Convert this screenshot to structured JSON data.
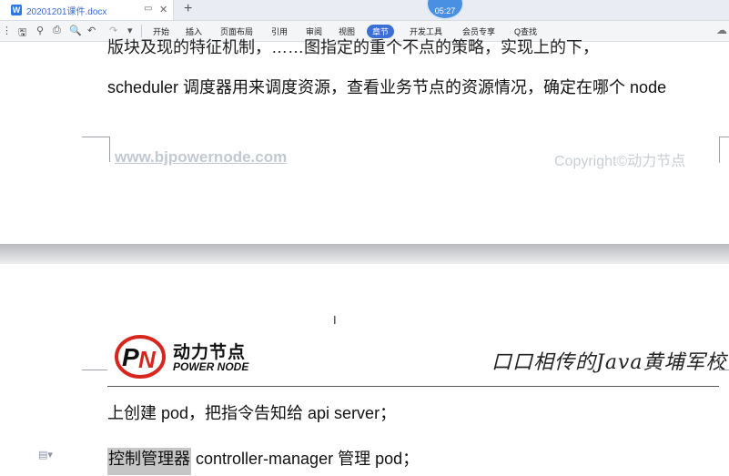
{
  "tab": {
    "icon": "W",
    "title": "20201201课件.docx",
    "monitor_glyph": "▭",
    "close_glyph": "✕",
    "new_tab_glyph": "+"
  },
  "clock": {
    "time": "05:27"
  },
  "quick_access": {
    "icons": [
      "menu-icon",
      "save-icon",
      "format-painter-icon",
      "print-icon",
      "print-preview-icon",
      "undo-icon",
      "redo-icon",
      "more-icon"
    ],
    "glyphs": [
      "⋮",
      "🖫",
      "⚲",
      "⎙",
      "🔍",
      "↶",
      "↷",
      "▾"
    ]
  },
  "menu": {
    "items": [
      "开始",
      "插入",
      "页面布局",
      "引用",
      "审阅",
      "视图",
      "章节",
      "开发工具",
      "会员专享"
    ],
    "active": "章节",
    "search_label": "Q查找",
    "cloud_glyph": "☁"
  },
  "document": {
    "cut_line": "版块及现的特征机制，……图指定的重个不点的策略，实现上的下，",
    "line1": "scheduler  调度器用来调度资源，查看业务节点的资源情况，确定在哪个 node",
    "footer_left": "www.bjpowernode.com",
    "footer_right": "Copyright©动力节点",
    "header_logo_cn": "动力节点",
    "header_logo_en": "POWER NODE",
    "header_slogan": "口口相传的Java黄埔军校",
    "line2": "上创建 pod，把指令告知给 api server；",
    "line3_highlight": "控制管理器",
    "line3_rest": " controller-manager 管理 pod；",
    "cursor_glyph": "I"
  },
  "colors": {
    "accent": "#3b6fd6",
    "logo_red": "#d7261e",
    "footer_gray": "#c3c9d1"
  }
}
